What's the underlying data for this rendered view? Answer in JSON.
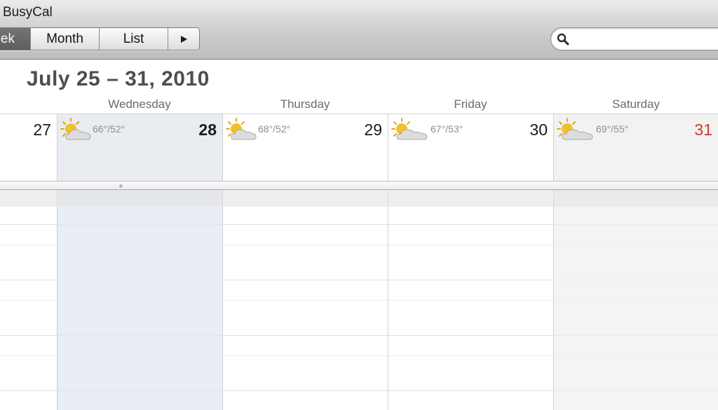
{
  "app": {
    "title": "BusyCal"
  },
  "toolbar": {
    "views": [
      {
        "label": "ek",
        "selected": true
      },
      {
        "label": "Month",
        "selected": false
      },
      {
        "label": "List",
        "selected": false
      }
    ],
    "next_icon": "play-right-icon",
    "search": {
      "placeholder": "",
      "value": ""
    }
  },
  "header": {
    "date_range": "July 25 – 31, 2010"
  },
  "days": [
    {
      "name": "",
      "number": "27",
      "temp": "",
      "today": false,
      "weekend": false
    },
    {
      "name": "Wednesday",
      "number": "28",
      "temp": "66°/52°",
      "today": true,
      "weekend": false
    },
    {
      "name": "Thursday",
      "number": "29",
      "temp": "68°/52°",
      "today": false,
      "weekend": false
    },
    {
      "name": "Friday",
      "number": "30",
      "temp": "67°/53°",
      "today": false,
      "weekend": false
    },
    {
      "name": "Saturday",
      "number": "31",
      "temp": "69°/55°",
      "today": false,
      "weekend": true
    }
  ],
  "colors": {
    "today_column": "#e9edf2",
    "weekend_column": "#f2f2f2",
    "weekend_number": "#d6332d",
    "sun": "#f2c02a",
    "cloud": "#dcdcdc"
  },
  "icons": {
    "weather": "partly-cloudy-icon",
    "search": "search-icon"
  }
}
